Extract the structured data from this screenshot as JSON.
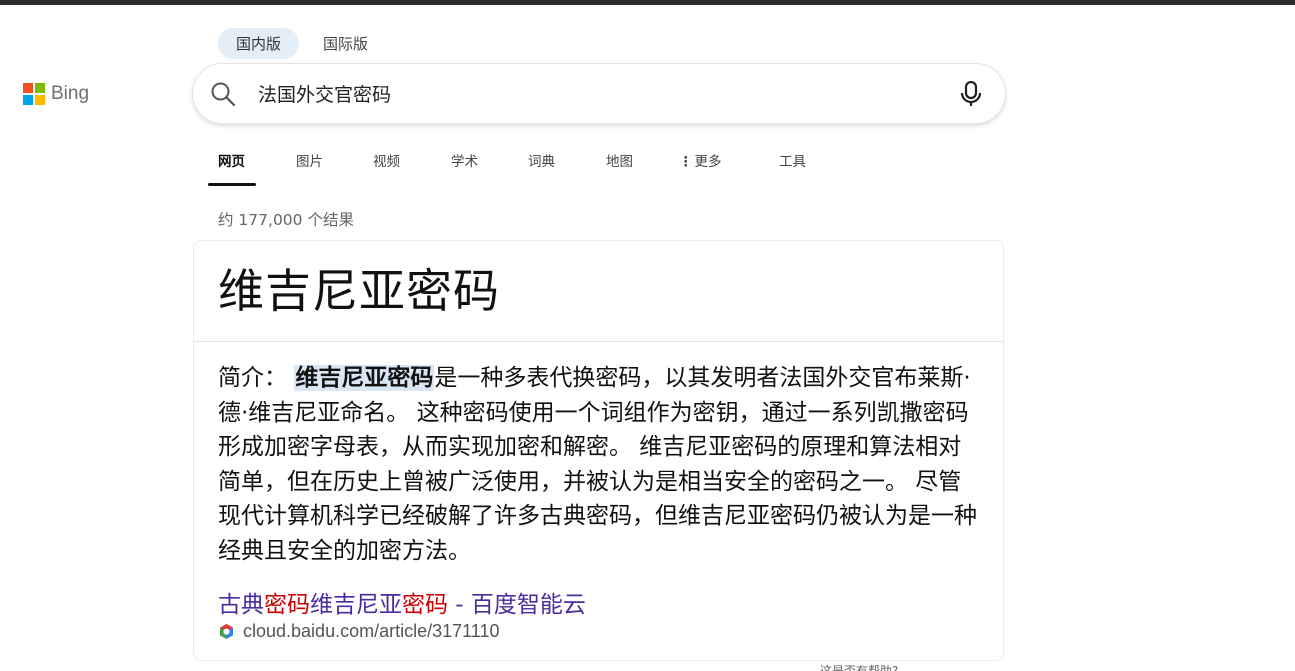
{
  "logo": {
    "text": "Bing",
    "colors": [
      "#f25022",
      "#7fba00",
      "#00a4ef",
      "#ffb900"
    ]
  },
  "scope_tabs": [
    {
      "label": "国内版",
      "active": true
    },
    {
      "label": "国际版",
      "active": false
    }
  ],
  "search": {
    "value": "法国外交官密码"
  },
  "nav": {
    "items": [
      {
        "label": "网页",
        "active": true
      },
      {
        "label": "图片"
      },
      {
        "label": "视频"
      },
      {
        "label": "学术"
      },
      {
        "label": "词典"
      },
      {
        "label": "地图"
      },
      {
        "label": "更多",
        "icon": "more-dots-icon"
      },
      {
        "label": "工具"
      }
    ]
  },
  "result_count": "约 177,000 个结果",
  "answer_card": {
    "title": "维吉尼亚密码",
    "intro_label": "简介：",
    "highlight": "维吉尼亚密码",
    "body": "是一种多表代换密码，以其发明者法国外交官布莱斯·德·维吉尼亚命名。 这种密码使用一个词组作为密钥，通过一系列凯撒密码形成加密字母表，从而实现加密和解密。 维吉尼亚密码的原理和算法相对简单，但在历史上曾被广泛使用，并被认为是相当安全的密码之一。 尽管现代计算机科学已经破解了许多古典密码，但维吉尼亚密码仍被认为是一种经典且安全的加密方法。",
    "source_link": {
      "part1": "古典",
      "part2": "密码",
      "part3": "维吉尼亚",
      "part4": "密码",
      "part5": " - 百度智能云"
    },
    "source_url": "cloud.baidu.com/article/3171110"
  },
  "feedback_text": "这是否有帮助?"
}
